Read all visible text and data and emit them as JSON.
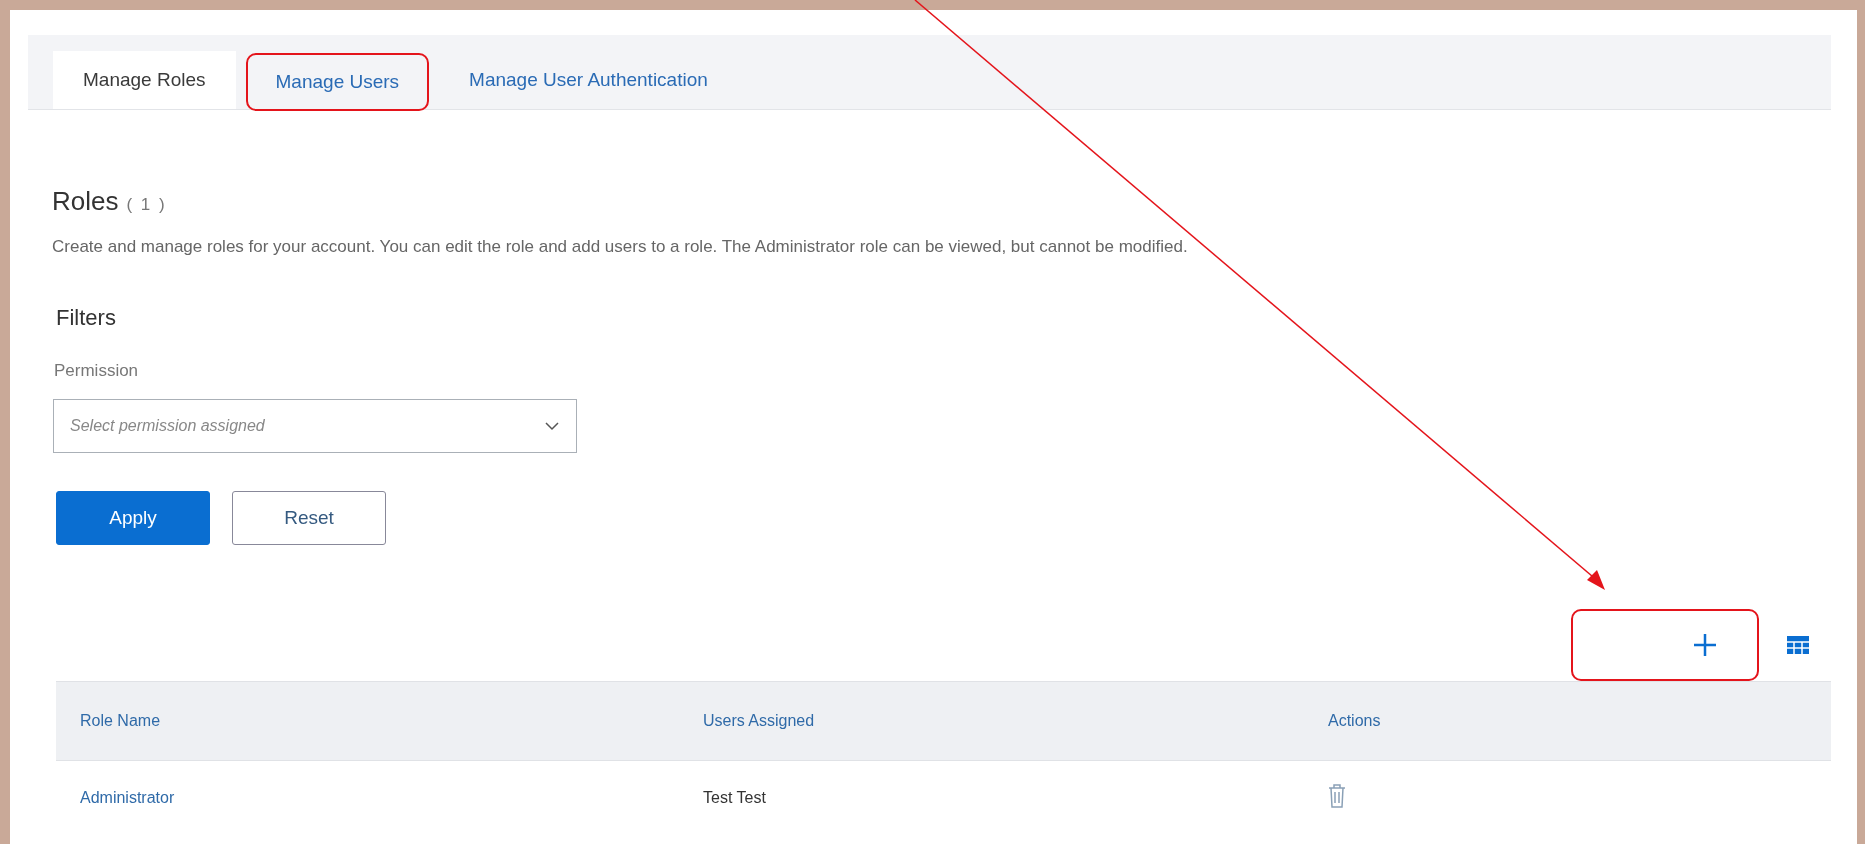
{
  "tabs": [
    {
      "label": "Manage Roles",
      "selected": true,
      "highlighted": false
    },
    {
      "label": "Manage Users",
      "selected": false,
      "highlighted": true
    },
    {
      "label": "Manage User Authentication",
      "selected": false,
      "highlighted": false
    }
  ],
  "header": {
    "title": "Roles",
    "count": "( 1 )",
    "description": "Create and manage roles for your account. You can edit the role and add users to a role. The Administrator role can be viewed, but cannot be modified."
  },
  "filters": {
    "title": "Filters",
    "permission": {
      "label": "Permission",
      "placeholder": "Select permission assigned"
    },
    "buttons": [
      {
        "label": "Apply",
        "kind": "primary"
      },
      {
        "label": "Reset",
        "kind": "secondary"
      }
    ]
  },
  "toolbar": {
    "add_highlighted": true
  },
  "table": {
    "columns": [
      "Role Name",
      "Users Assigned",
      "Actions"
    ],
    "rows": [
      {
        "role": "Administrator",
        "users": "Test Test"
      }
    ]
  }
}
